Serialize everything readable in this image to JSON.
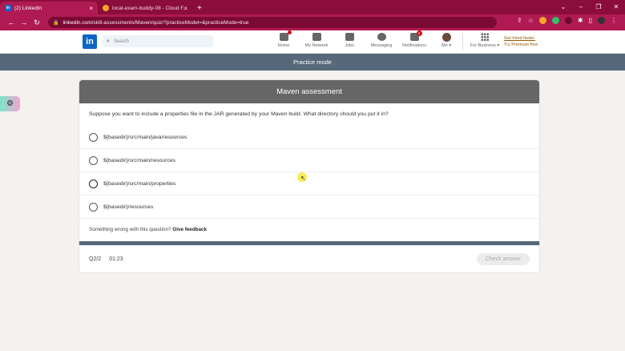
{
  "browser": {
    "tabs": [
      {
        "title": "(2) LinkedIn",
        "active": true,
        "favicon": "linkedin-icon"
      },
      {
        "title": "local-exam-buddy-08 - Cloud F...",
        "active": false,
        "favicon": "cloud-icon"
      }
    ],
    "new_tab": "+",
    "url_host": "linkedin.com",
    "url_path": "/skill-assessments/Maven/quiz/?practiceModel=&practiceMode=true",
    "colors": {
      "frame": "#8b0d3a",
      "toolbar": "#b01a52"
    }
  },
  "linkedin": {
    "logo": "in",
    "search_placeholder": "Search",
    "nav": [
      {
        "label": "Home",
        "icon": "home-icon",
        "badge": ""
      },
      {
        "label": "My Network",
        "icon": "network-icon",
        "badge": ""
      },
      {
        "label": "Jobs",
        "icon": "jobs-icon",
        "badge": ""
      },
      {
        "label": "Messaging",
        "icon": "messaging-icon",
        "badge": ""
      },
      {
        "label": "Notifications",
        "icon": "bell-icon",
        "badge": "2"
      },
      {
        "label": "Me",
        "icon": "avatar-icon",
        "badge": ""
      },
      {
        "label": "For Business",
        "icon": "grid-icon",
        "badge": ""
      }
    ],
    "premium_line1": "Get hired faster.",
    "premium_line2": "Try Premium free",
    "brand_color": "#0a66c2"
  },
  "practice_bar": {
    "label": "Practice mode",
    "color": "#56687a"
  },
  "assessment": {
    "title": "Maven assessment",
    "question": "Suppose you want to include a properties file in the JAR generated by your Maven build. What directory should you put it in?",
    "options": [
      "${basedir}/src/main/java/resources",
      "${basedir}/src/main/resources",
      "${basedir}/src/main/properties",
      "${basedir}/resources"
    ],
    "feedback_prefix": "Something wrong with this question?",
    "feedback_link": "Give feedback",
    "progress_label": "Q2/2",
    "timer": "01:23",
    "check_answer": "Check answer"
  }
}
